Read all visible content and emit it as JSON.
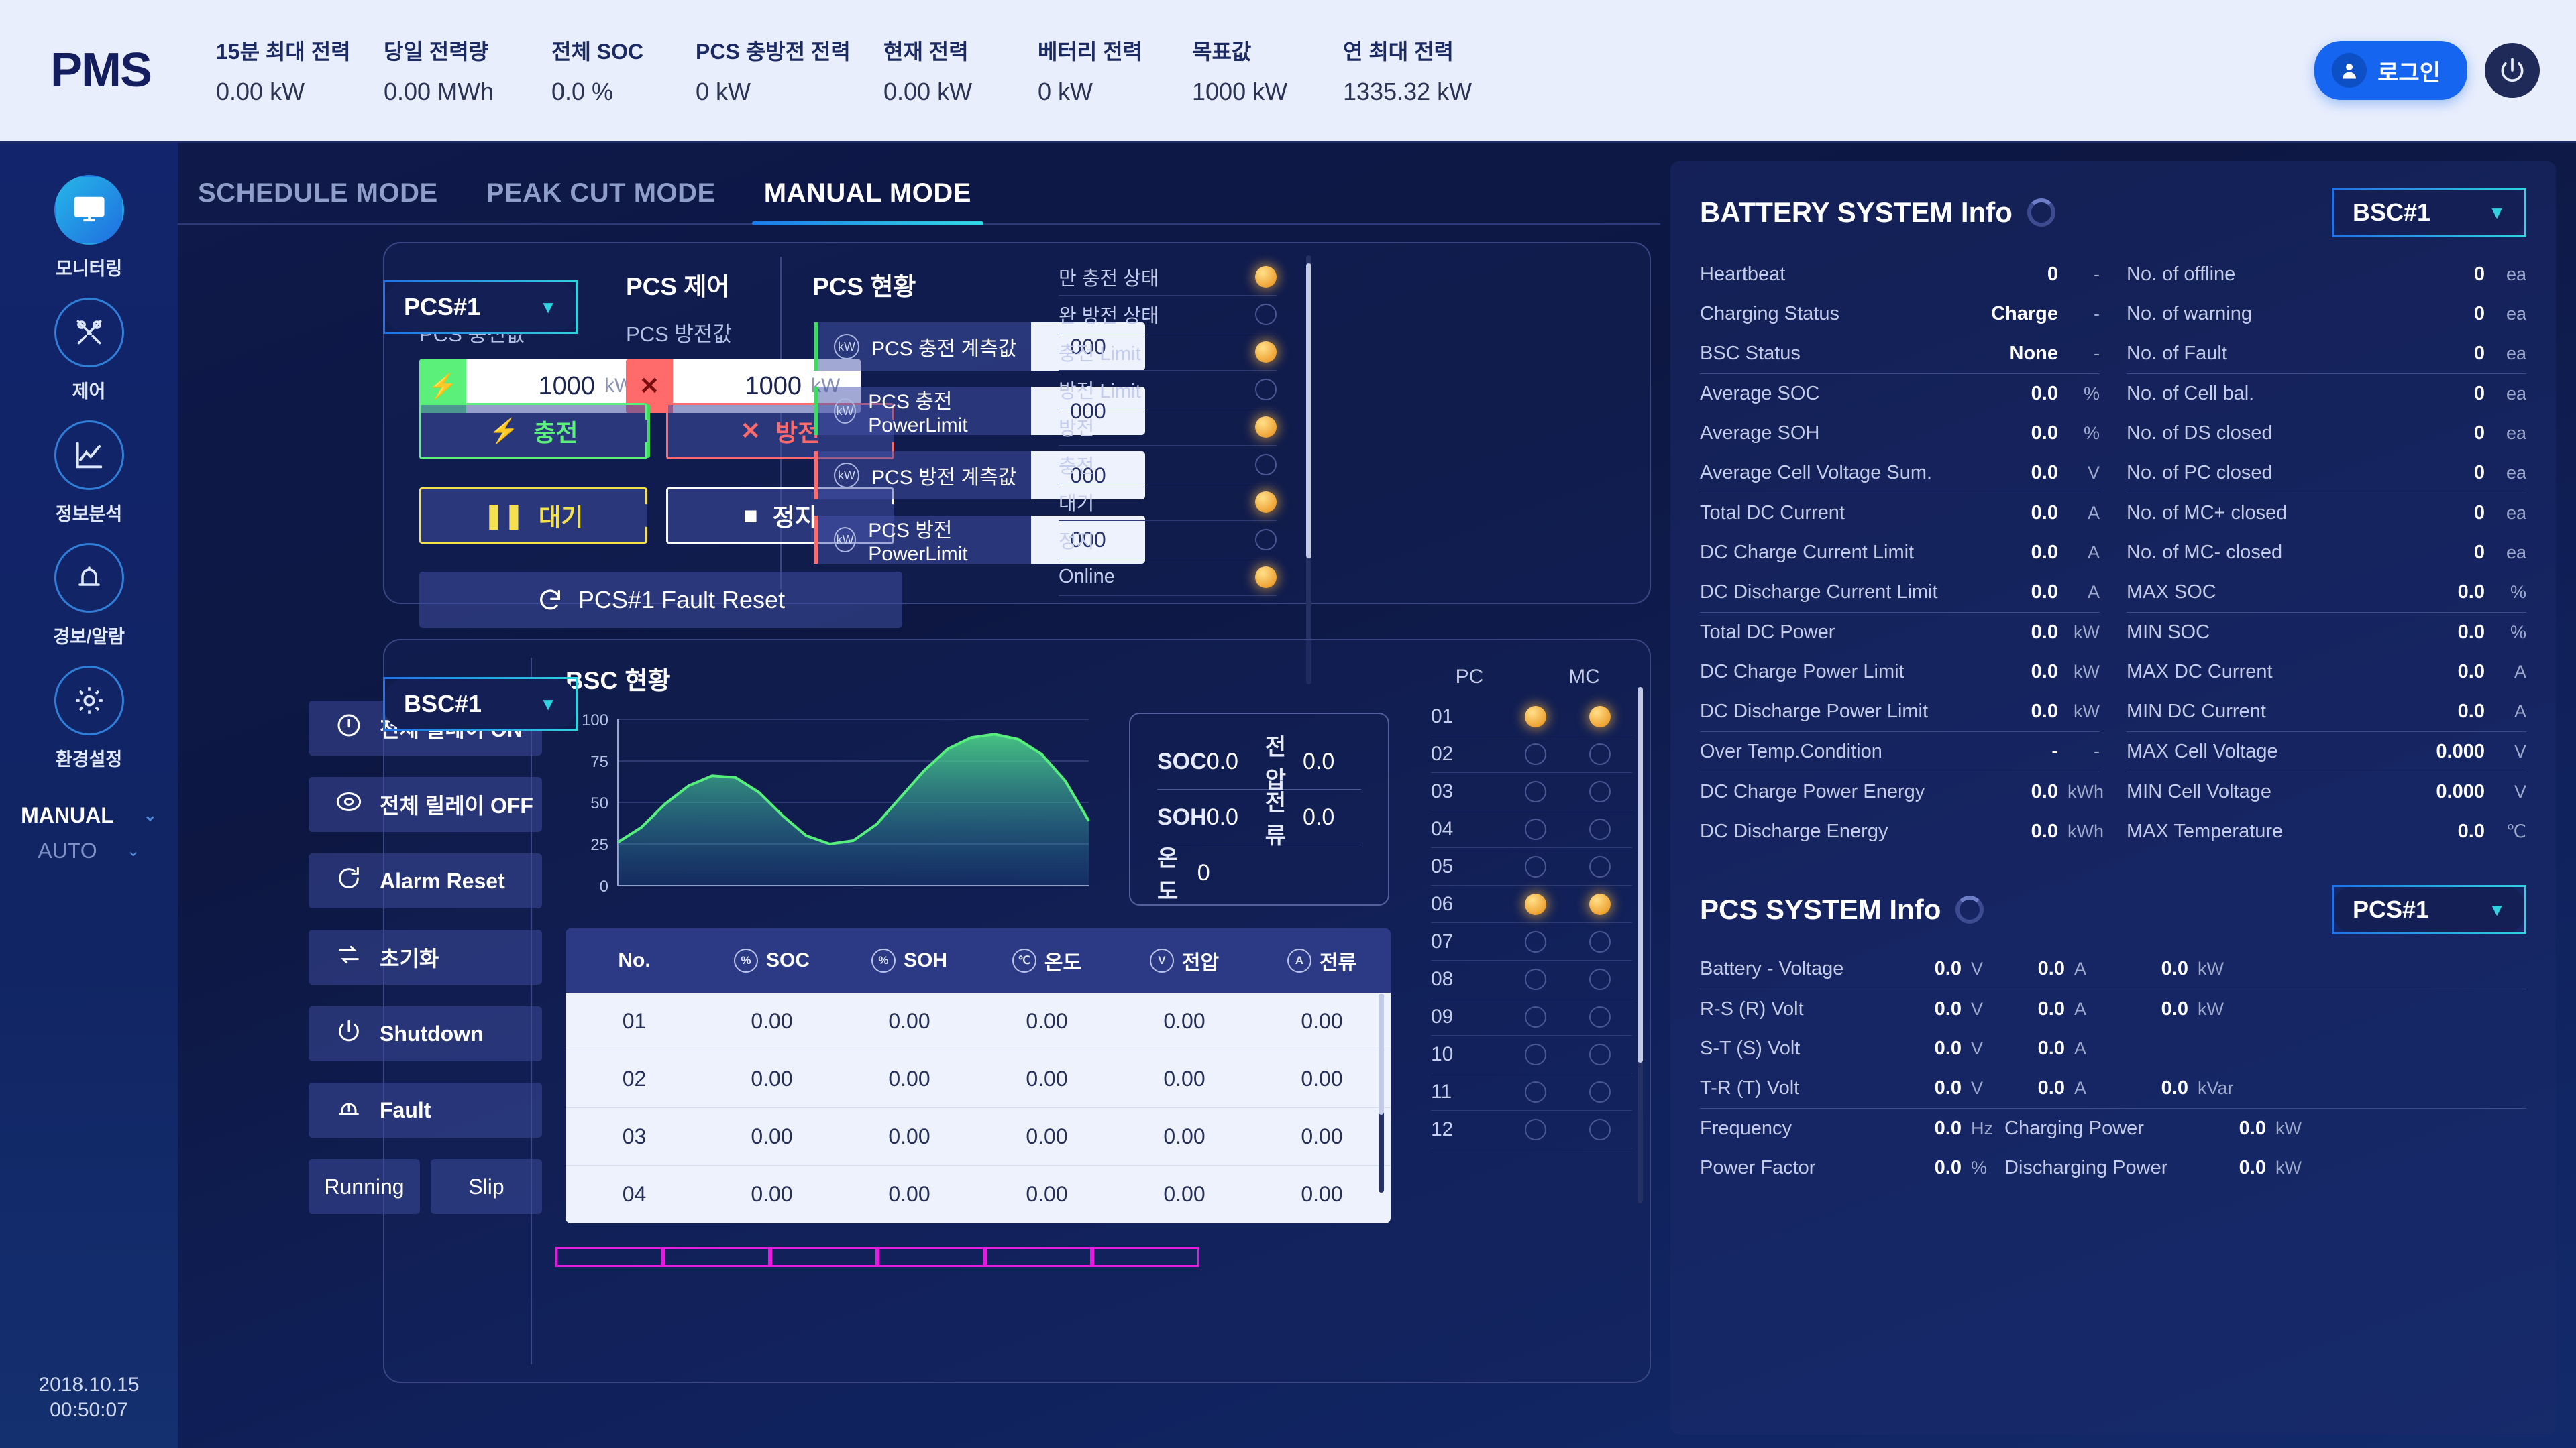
{
  "header": {
    "logo": "PMS",
    "stats": [
      {
        "label": "15분 최대 전력",
        "value": "0.00 kW"
      },
      {
        "label": "당일 전력량",
        "value": "0.00 MWh"
      },
      {
        "label": "전체 SOC",
        "value": "0.0 %"
      },
      {
        "label": "PCS 충방전 전력",
        "value": "0 kW"
      },
      {
        "label": "현재 전력",
        "value": "0.00 kW"
      },
      {
        "label": "베터리 전력",
        "value": "0 kW"
      },
      {
        "label": "목표값",
        "value": "1000 kW"
      },
      {
        "label": "연 최대 전력",
        "value": "1335.32 kW"
      }
    ],
    "login_label": "로그인",
    "accent": "#1565f0"
  },
  "sidebar": {
    "items": [
      {
        "label": "모니터링",
        "icon": "monitor-icon",
        "active": true
      },
      {
        "label": "제어",
        "icon": "tools-icon",
        "active": false
      },
      {
        "label": "정보분석",
        "icon": "chart-icon",
        "active": false
      },
      {
        "label": "경보/알람",
        "icon": "bell-icon",
        "active": false
      },
      {
        "label": "환경설정",
        "icon": "gear-icon",
        "active": false
      }
    ],
    "modes": [
      {
        "label": "MANUAL",
        "selected": true
      },
      {
        "label": "AUTO",
        "selected": false
      }
    ],
    "clock_date": "2018.10.15",
    "clock_time": "00:50:07"
  },
  "tabs": [
    {
      "label": "SCHEDULE MODE",
      "active": false
    },
    {
      "label": "PEAK CUT MODE",
      "active": false
    },
    {
      "label": "MANUAL MODE",
      "active": true
    }
  ],
  "pcs_panel": {
    "selector": "PCS#1",
    "control_title": "PCS 제어",
    "status_title": "PCS 현황",
    "charge_field": {
      "label": "PCS 충전값",
      "value": "1000",
      "unit": "kW",
      "icon": "bolt-icon"
    },
    "discharge_field": {
      "label": "PCS 방전값",
      "value": "1000",
      "unit": "kW",
      "icon": "x-icon"
    },
    "buttons": [
      {
        "label": "충전",
        "glyph": "⚡",
        "color": "green"
      },
      {
        "label": "방전",
        "glyph": "✕",
        "color": "red"
      },
      {
        "label": "대기",
        "glyph": "❚❚",
        "color": "yellow"
      },
      {
        "label": "정지",
        "glyph": "■",
        "color": "white"
      }
    ],
    "fault_reset_label": "PCS#1 Fault Reset",
    "status_rows": [
      {
        "label": "PCS 충전 계측값",
        "value": "000",
        "bar": "#3ddc5f"
      },
      {
        "label": "PCS 충전 PowerLimit",
        "value": "000",
        "bar": "#3ddc5f"
      },
      {
        "label": "PCS 방전 계측값",
        "value": "000",
        "bar": "#ff6b6b"
      },
      {
        "label": "PCS 방전 PowerLimit",
        "value": "000",
        "bar": "#ff6b6b"
      }
    ],
    "indicators": [
      {
        "label": "만 충전 상태",
        "on": true
      },
      {
        "label": "완 방전 상태",
        "on": false
      },
      {
        "label": "충전 Limit",
        "on": true
      },
      {
        "label": "방전 Limit",
        "on": false
      },
      {
        "label": "방전",
        "on": true
      },
      {
        "label": "충전",
        "on": false
      },
      {
        "label": "대기",
        "on": true
      },
      {
        "label": "정지",
        "on": false
      },
      {
        "label": "Online",
        "on": true
      }
    ]
  },
  "bsc_panel": {
    "selector": "BSC#1",
    "title": "BSC 현황",
    "buttons": [
      {
        "label": "전체 릴레이 ON",
        "icon": "power-on-icon"
      },
      {
        "label": "전체 릴레이 OFF",
        "icon": "power-off-icon"
      },
      {
        "label": "Alarm Reset",
        "icon": "refresh-icon"
      },
      {
        "label": "초기화",
        "icon": "loop-icon"
      },
      {
        "label": "Shutdown",
        "icon": "power-icon"
      },
      {
        "label": "Fault",
        "icon": "alarm-icon"
      }
    ],
    "small_buttons": [
      {
        "label": "Running"
      },
      {
        "label": "Slip"
      }
    ],
    "kv": [
      {
        "k": "SOC",
        "v": "0.0",
        "k2": "전압",
        "v2": "0.0"
      },
      {
        "k": "SOH",
        "v": "0.0",
        "k2": "전류",
        "v2": "0.0"
      },
      {
        "k": "온도",
        "v": "0",
        "k2": "",
        "v2": ""
      }
    ],
    "table": {
      "columns": [
        {
          "label": "No.",
          "unit": ""
        },
        {
          "label": "SOC",
          "unit": "%"
        },
        {
          "label": "SOH",
          "unit": "%"
        },
        {
          "label": "온도",
          "unit": "℃"
        },
        {
          "label": "전압",
          "unit": "V"
        },
        {
          "label": "전류",
          "unit": "A"
        }
      ],
      "rows": [
        [
          "01",
          "0.00",
          "0.00",
          "0.00",
          "0.00",
          "0.00"
        ],
        [
          "02",
          "0.00",
          "0.00",
          "0.00",
          "0.00",
          "0.00"
        ],
        [
          "03",
          "0.00",
          "0.00",
          "0.00",
          "0.00",
          "0.00"
        ],
        [
          "04",
          "0.00",
          "0.00",
          "0.00",
          "0.00",
          "0.00"
        ]
      ]
    },
    "pcmc": {
      "headers": [
        "PC",
        "MC"
      ],
      "rows": [
        {
          "no": "01",
          "pc": true,
          "mc": true
        },
        {
          "no": "02",
          "pc": false,
          "mc": false
        },
        {
          "no": "03",
          "pc": false,
          "mc": false
        },
        {
          "no": "04",
          "pc": false,
          "mc": false
        },
        {
          "no": "05",
          "pc": false,
          "mc": false
        },
        {
          "no": "06",
          "pc": true,
          "mc": true
        },
        {
          "no": "07",
          "pc": false,
          "mc": false
        },
        {
          "no": "08",
          "pc": false,
          "mc": false
        },
        {
          "no": "09",
          "pc": false,
          "mc": false
        },
        {
          "no": "10",
          "pc": false,
          "mc": false
        },
        {
          "no": "11",
          "pc": false,
          "mc": false
        },
        {
          "no": "12",
          "pc": false,
          "mc": false
        }
      ]
    }
  },
  "chart_data": {
    "type": "area",
    "title": "BSC 현황",
    "xlabel": "",
    "ylabel": "",
    "ylim": [
      0,
      100
    ],
    "yticks": [
      0,
      25,
      50,
      75,
      100
    ],
    "grid": true,
    "legend": "none",
    "line_color": "#56ee7c",
    "series": [
      {
        "name": "SOC",
        "x": [
          0,
          5,
          10,
          15,
          20,
          25,
          30,
          35,
          40,
          45,
          50,
          55,
          60,
          65,
          70,
          75,
          80,
          85,
          90,
          95,
          100
        ],
        "values": [
          26,
          35,
          49,
          60,
          66,
          65,
          56,
          42,
          30,
          25,
          27,
          37,
          53,
          69,
          82,
          89,
          91,
          88,
          79,
          63,
          39
        ]
      }
    ]
  },
  "battery_info": {
    "title": "BATTERY SYSTEM Info",
    "selector": "BSC#1",
    "left_rows": [
      {
        "label": "Heartbeat",
        "value": "0",
        "unit": "-"
      },
      {
        "label": "Charging Status",
        "value": "Charge",
        "unit": "-"
      },
      {
        "label": "BSC Status",
        "value": "None",
        "unit": "-"
      },
      {
        "label": "Average SOC",
        "value": "0.0",
        "unit": "%"
      },
      {
        "label": "Average SOH",
        "value": "0.0",
        "unit": "%"
      },
      {
        "label": "Average Cell Voltage Sum.",
        "value": "0.0",
        "unit": "V"
      },
      {
        "label": "Total DC Current",
        "value": "0.0",
        "unit": "A"
      },
      {
        "label": "DC Charge Current Limit",
        "value": "0.0",
        "unit": "A"
      },
      {
        "label": "DC Discharge Current Limit",
        "value": "0.0",
        "unit": "A"
      },
      {
        "label": "Total DC Power",
        "value": "0.0",
        "unit": "kW"
      },
      {
        "label": "DC Charge Power Limit",
        "value": "0.0",
        "unit": "kW"
      },
      {
        "label": "DC Discharge Power Limit",
        "value": "0.0",
        "unit": "kW"
      },
      {
        "label": "Over Temp.Condition",
        "value": "-",
        "unit": "-"
      },
      {
        "label": "DC Charge Power Energy",
        "value": "0.0",
        "unit": "kWh"
      },
      {
        "label": "DC Discharge Energy",
        "value": "0.0",
        "unit": "kWh"
      }
    ],
    "right_rows": [
      {
        "label": "No. of offline",
        "value": "0",
        "unit": "ea"
      },
      {
        "label": "No. of warning",
        "value": "0",
        "unit": "ea"
      },
      {
        "label": "No. of Fault",
        "value": "0",
        "unit": "ea"
      },
      {
        "label": "No. of Cell bal.",
        "value": "0",
        "unit": "ea"
      },
      {
        "label": "No. of DS closed",
        "value": "0",
        "unit": "ea"
      },
      {
        "label": "No. of PC closed",
        "value": "0",
        "unit": "ea"
      },
      {
        "label": "No. of MC+ closed",
        "value": "0",
        "unit": "ea"
      },
      {
        "label": "No. of MC- closed",
        "value": "0",
        "unit": "ea"
      },
      {
        "label": "MAX SOC",
        "value": "0.0",
        "unit": "%"
      },
      {
        "label": "MIN SOC",
        "value": "0.0",
        "unit": "%"
      },
      {
        "label": "MAX DC Current",
        "value": "0.0",
        "unit": "A"
      },
      {
        "label": "MIN DC Current",
        "value": "0.0",
        "unit": "A"
      },
      {
        "label": "MAX Cell Voltage",
        "value": "0.000",
        "unit": "V"
      },
      {
        "label": "MIN Cell Voltage",
        "value": "0.000",
        "unit": "V"
      },
      {
        "label": "MAX Temperature",
        "value": "0.0",
        "unit": "℃"
      }
    ]
  },
  "pcs_info": {
    "title": "PCS SYSTEM Info",
    "selector": "PCS#1",
    "rows": [
      {
        "label": "Battery - Voltage",
        "v1": "0.0",
        "u1": "V",
        "v2": "0.0",
        "u2": "A",
        "v3": "0.0",
        "u3": "kW"
      },
      {
        "label": "R-S (R) Volt",
        "v1": "0.0",
        "u1": "V",
        "v2": "0.0",
        "u2": "A",
        "v3": "0.0",
        "u3": "kW"
      },
      {
        "label": "S-T (S) Volt",
        "v1": "0.0",
        "u1": "V",
        "v2": "0.0",
        "u2": "A",
        "v3": "",
        "u3": ""
      },
      {
        "label": "T-R (T) Volt",
        "v1": "0.0",
        "u1": "V",
        "v2": "0.0",
        "u2": "A",
        "v3": "0.0",
        "u3": "kVar"
      }
    ],
    "bottom_rows": [
      {
        "label": "Frequency",
        "value": "0.0",
        "unit": "Hz",
        "label2": "Charging Power",
        "value2": "0.0",
        "unit2": "kW"
      },
      {
        "label": "Power Factor",
        "value": "0.0",
        "unit": "%",
        "label2": "Discharging Power",
        "value2": "0.0",
        "unit2": "kW"
      }
    ]
  }
}
